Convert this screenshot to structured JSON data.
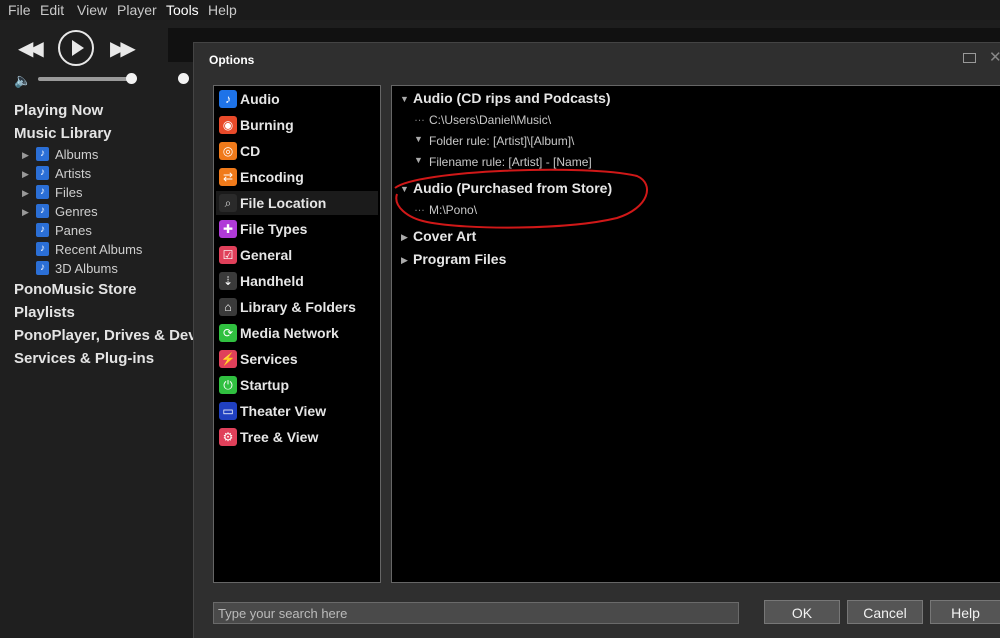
{
  "menu": [
    "File",
    "Edit",
    "View",
    "Player",
    "Tools",
    "Help"
  ],
  "sidebar": {
    "headings": [
      "Playing Now",
      "Music Library",
      "PonoMusic Store",
      "Playlists",
      "PonoPlayer, Drives & Devices",
      "Services & Plug-ins"
    ],
    "library_items": [
      "Albums",
      "Artists",
      "Files",
      "Genres",
      "Panes",
      "Recent Albums",
      "3D Albums"
    ]
  },
  "dialog": {
    "title": "Options",
    "categories": [
      {
        "label": "Audio",
        "icon": "music-note-icon",
        "color": "#1e73e8"
      },
      {
        "label": "Burning",
        "icon": "burn-disc-icon",
        "color": "#e84a2a"
      },
      {
        "label": "CD",
        "icon": "cd-icon",
        "color": "#f07a1a"
      },
      {
        "label": "Encoding",
        "icon": "encoding-icon",
        "color": "#f07a1a"
      },
      {
        "label": "File Location",
        "icon": "file-search-icon",
        "color": "#c8c8c8"
      },
      {
        "label": "File Types",
        "icon": "puzzle-icon",
        "color": "#b03ad8"
      },
      {
        "label": "General",
        "icon": "check-box-icon",
        "color": "#e0405a"
      },
      {
        "label": "Handheld",
        "icon": "usb-icon",
        "color": "#3a3a3a"
      },
      {
        "label": "Library & Folders",
        "icon": "house-icon",
        "color": "#3a3a3a"
      },
      {
        "label": "Media Network",
        "icon": "network-icon",
        "color": "#30c040"
      },
      {
        "label": "Services",
        "icon": "plug-icon",
        "color": "#e0405a"
      },
      {
        "label": "Startup",
        "icon": "power-icon",
        "color": "#30c040"
      },
      {
        "label": "Theater View",
        "icon": "monitor-icon",
        "color": "#2040c0"
      },
      {
        "label": "Tree & View",
        "icon": "gear-icon",
        "color": "#e0405a"
      }
    ],
    "selected_category": "File Location",
    "sections": {
      "cd_rips": {
        "title": "Audio (CD rips and Podcasts)",
        "path": "C:\\Users\\Daniel\\Music\\",
        "folder_rule": "Folder rule: [Artist]\\[Album]\\",
        "filename_rule": "Filename rule: [Artist] - [Name]"
      },
      "purchased": {
        "title": "Audio (Purchased from Store)",
        "path": "M:\\Pono\\"
      },
      "cover_art": "Cover Art",
      "program_files": "Program Files"
    },
    "search_placeholder": "Type your search here",
    "buttons": {
      "ok": "OK",
      "cancel": "Cancel",
      "help": "Help"
    },
    "annotation_color": "#d01818"
  }
}
